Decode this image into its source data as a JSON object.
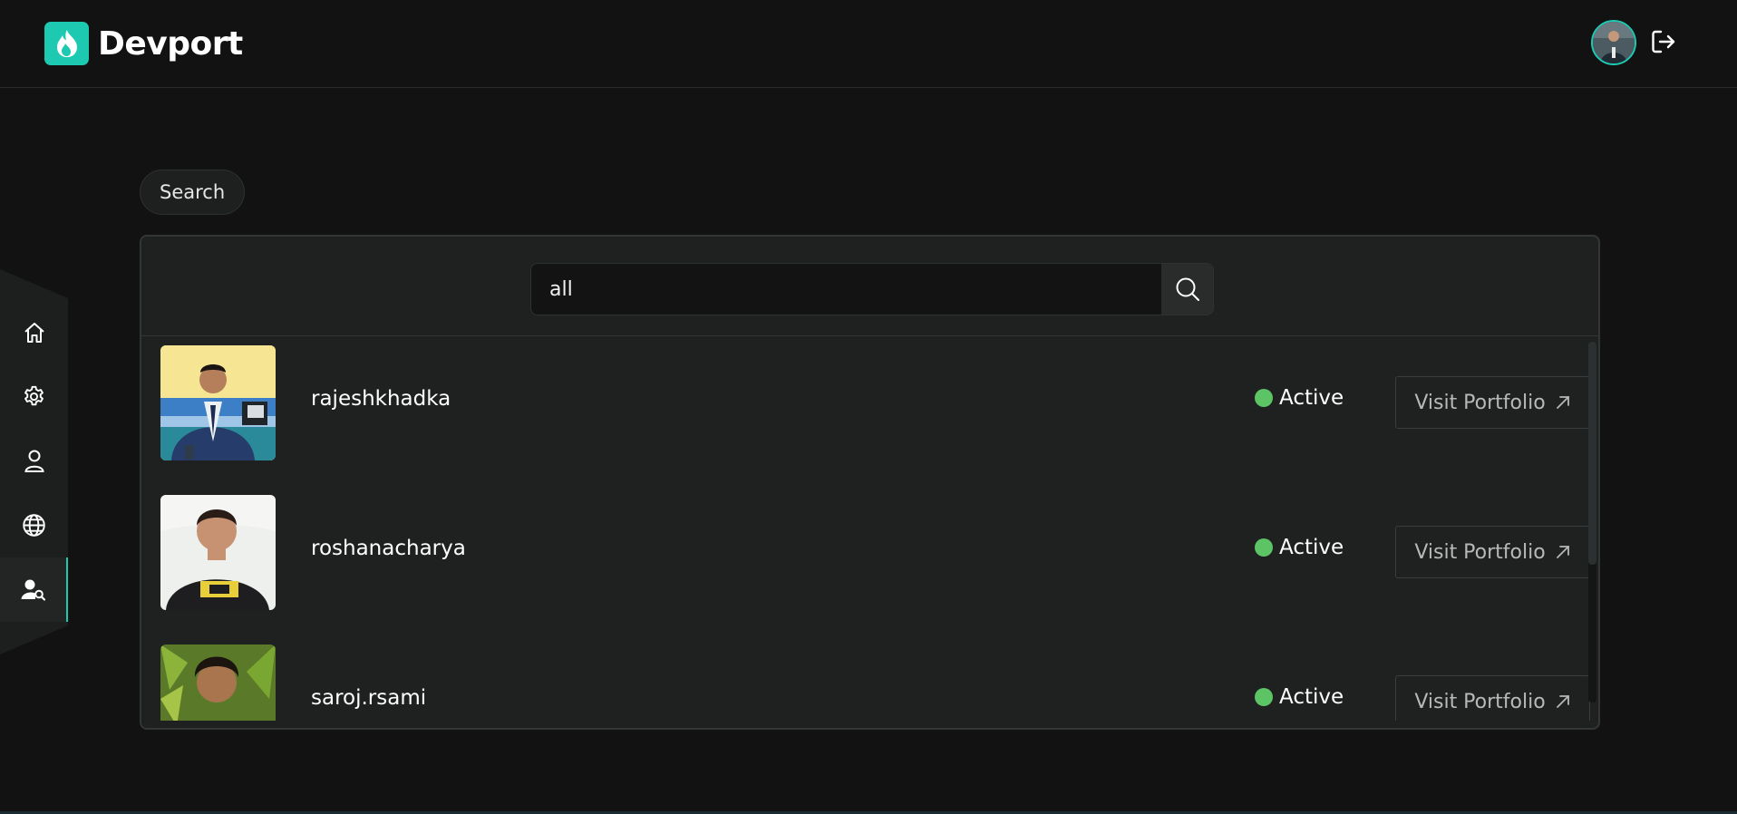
{
  "brand": {
    "name": "Devport",
    "accent": "#1ec9b2"
  },
  "header": {
    "avatar_icon": "user-avatar",
    "logout_icon": "logout-icon"
  },
  "sidebar": {
    "items": [
      {
        "icon": "home-icon"
      },
      {
        "icon": "gear-icon"
      },
      {
        "icon": "user-icon"
      },
      {
        "icon": "globe-icon"
      },
      {
        "icon": "user-search-icon",
        "active": true
      }
    ]
  },
  "search": {
    "tag_label": "Search",
    "value": "all",
    "placeholder": "",
    "button_icon": "search-icon"
  },
  "results": [
    {
      "username": "rajeshkhadka",
      "status": "Active",
      "action": "Visit Portfolio"
    },
    {
      "username": "roshanacharya",
      "status": "Active",
      "action": "Visit Portfolio"
    },
    {
      "username": "saroj.rsami",
      "status": "Active",
      "action": "Visit Portfolio"
    }
  ],
  "colors": {
    "status_active": "#5cc465",
    "background": "#121212",
    "panel": "#1f2121"
  }
}
